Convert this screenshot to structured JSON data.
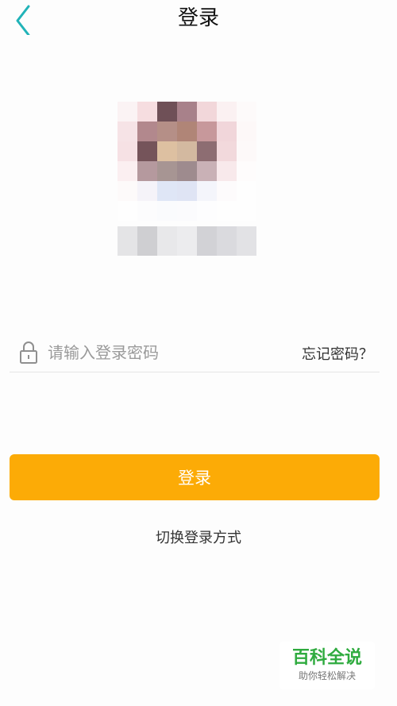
{
  "header": {
    "title": "登录",
    "back_icon": "chevron-left-icon",
    "accent_color": "#21b3b8"
  },
  "profile": {
    "avatar_icon": "pixelated-avatar",
    "username_icon": "pixelated-username"
  },
  "password": {
    "placeholder": "请输入登录密码",
    "value": "",
    "lock_icon": "lock-icon",
    "forgot_label": "忘记密码？"
  },
  "login_button": {
    "label": "登录",
    "color": "#fcab06"
  },
  "switch_login": {
    "label": "切换登录方式"
  },
  "watermark": {
    "title": "百科全说",
    "subtitle": "助你轻松解决"
  }
}
